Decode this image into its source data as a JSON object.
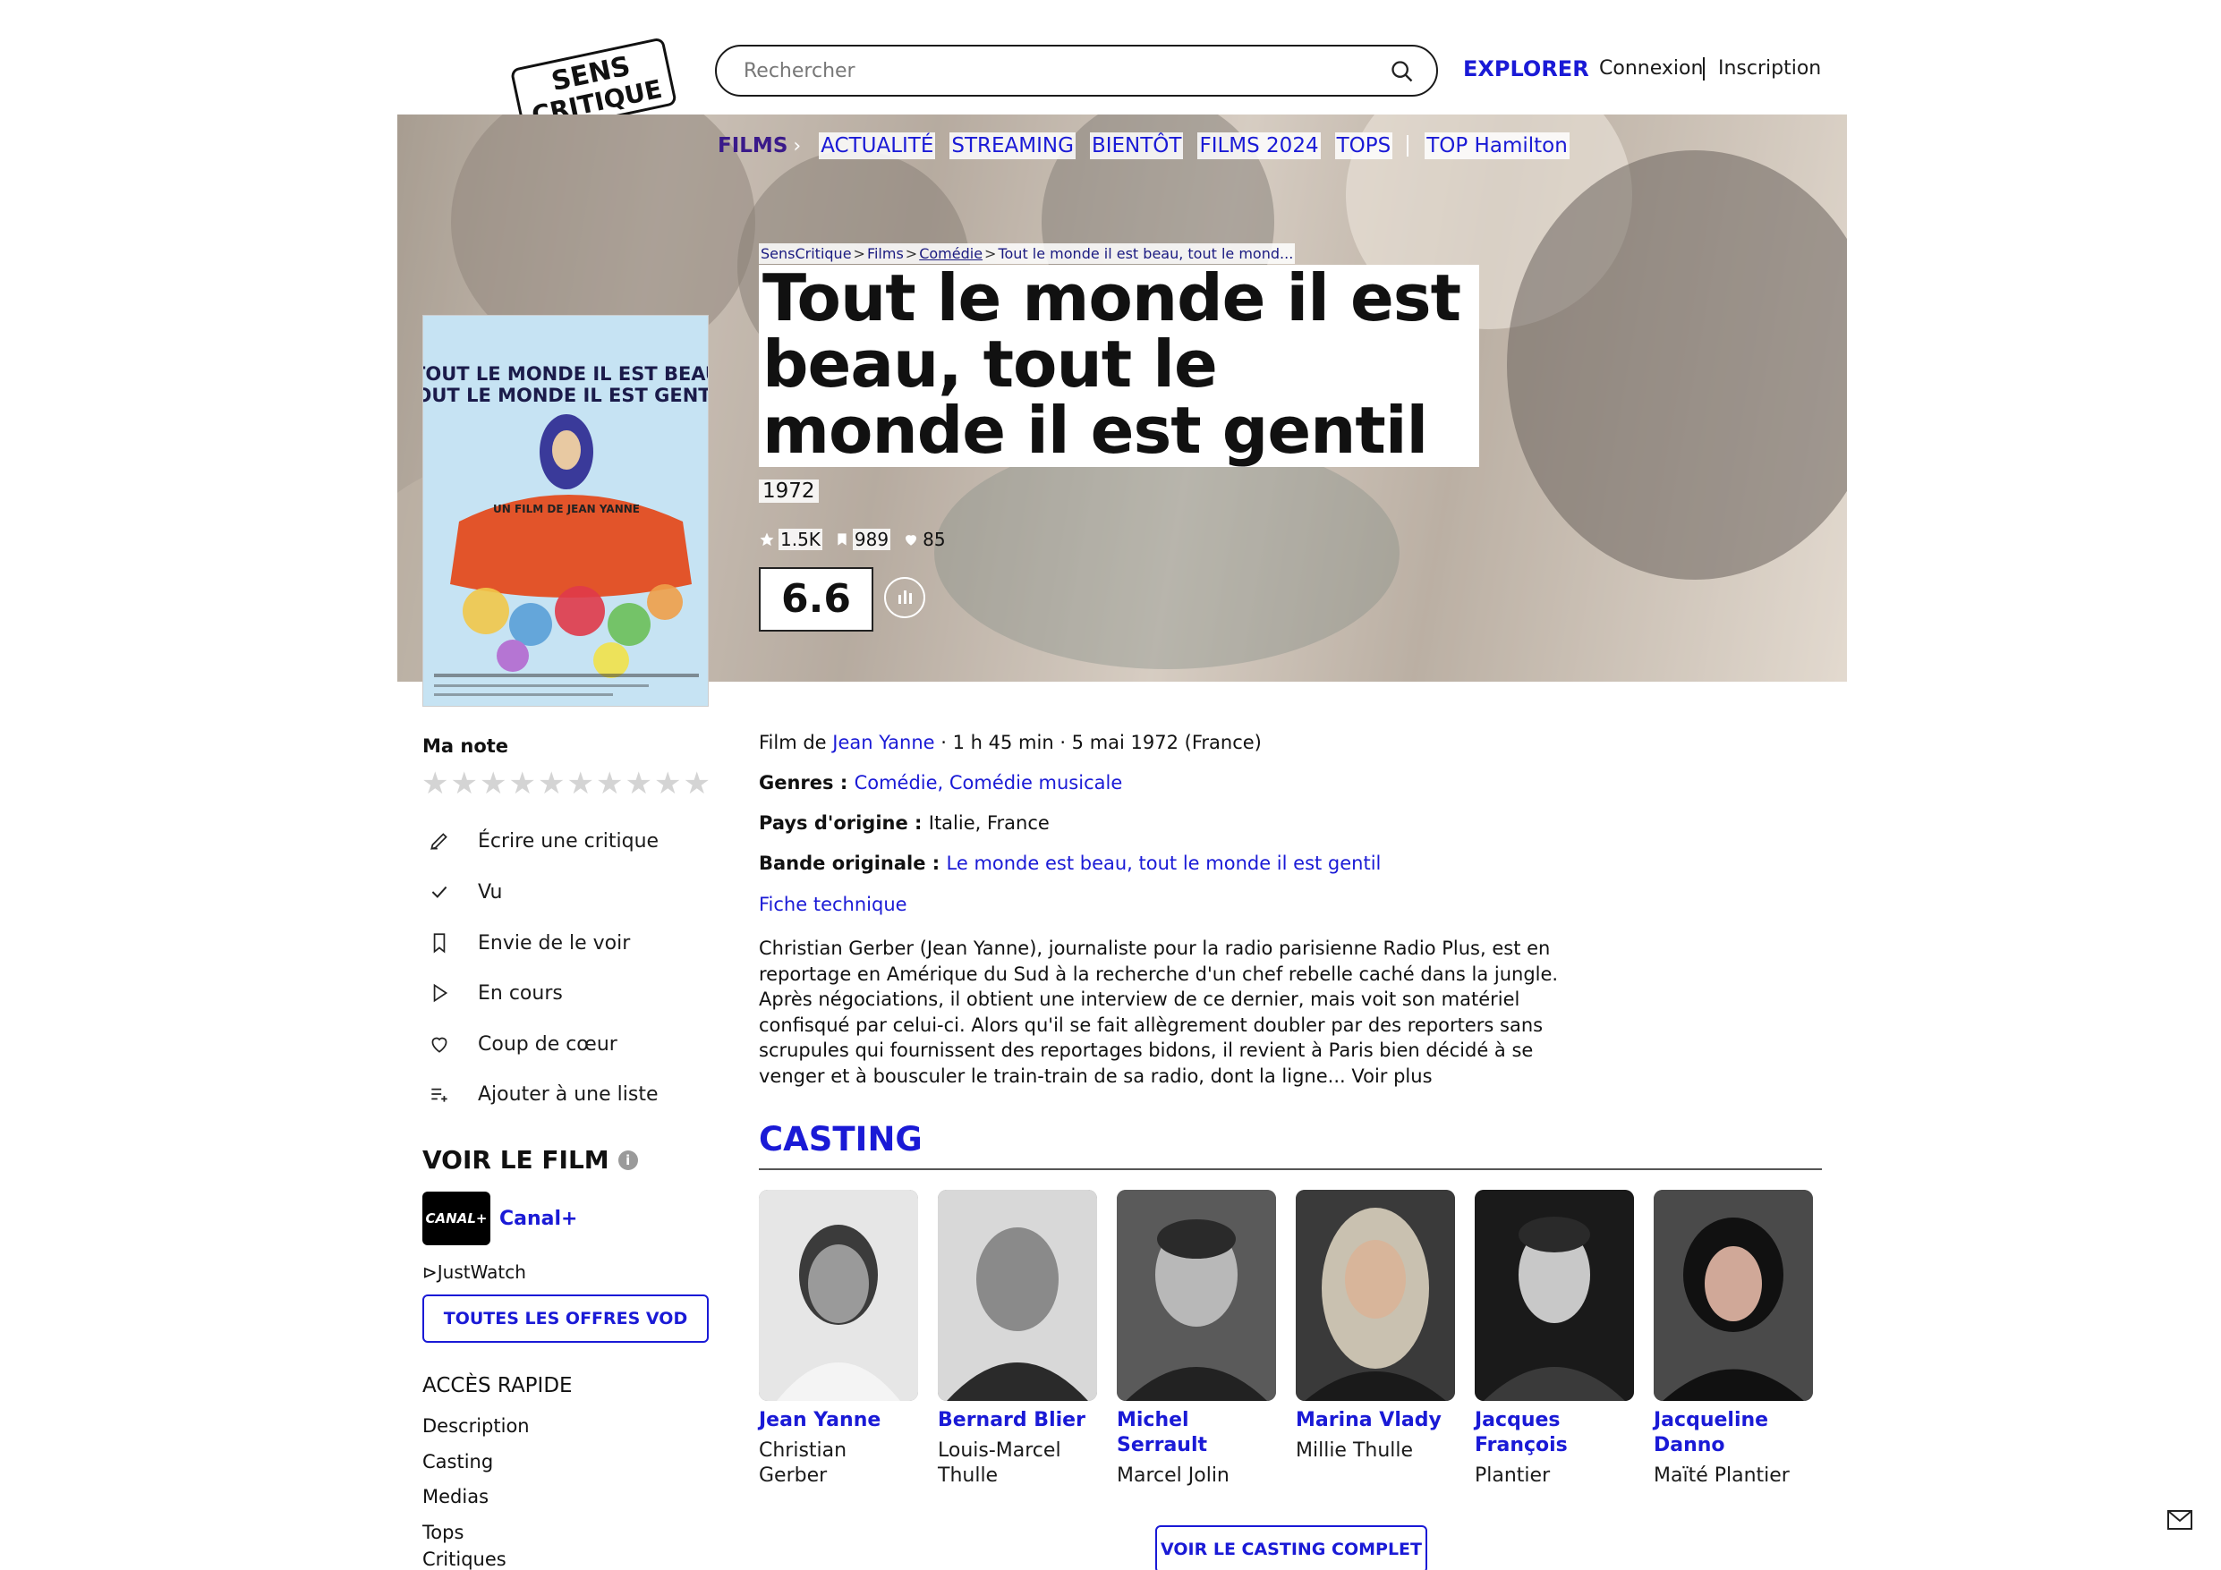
{
  "header": {
    "logo_text": [
      "SENS",
      "CRITIQUE"
    ],
    "search_placeholder": "Rechercher",
    "explorer": "EXPLORER",
    "connexion": "Connexion",
    "inscription": "Inscription"
  },
  "nav": {
    "films": "FILMS",
    "items": [
      "ACTUALITÉ",
      "STREAMING",
      "BIENTÔT",
      "FILMS 2024",
      "TOPS"
    ],
    "top": "TOP Hamilton"
  },
  "breadcrumb": [
    "SensCritique",
    "Films",
    "Comédie",
    "Tout le monde il est beau, tout le mond..."
  ],
  "film": {
    "title": "Tout le monde il est beau, tout le monde il est gentil",
    "year": "1972",
    "stats": {
      "ratings": "1.5K",
      "wishlist": "989",
      "favorites": "85"
    },
    "score": "6.6"
  },
  "poster": {
    "line1": "TOUT LE MONDE IL EST BEAU",
    "line2": "TOUT LE MONDE IL EST GENTIL",
    "subtitle": "UN FILM DE JEAN YANNE"
  },
  "left": {
    "ma_note": "Ma note",
    "actions": [
      "Écrire une critique",
      "Vu",
      "Envie de le voir",
      "En cours",
      "Coup de cœur",
      "Ajouter à une liste"
    ],
    "voir_le_film": "VOIR LE FILM",
    "info_glyph": "i",
    "canal_logo": "CANAL+",
    "canal_label": "Canal+",
    "justwatch": "JustWatch",
    "vod_button": "TOUTES LES OFFRES VOD",
    "acces_rapide": "ACCÈS RAPIDE",
    "quick_links": [
      "Description",
      "Casting",
      "Medias",
      "Tops",
      "Critiques"
    ]
  },
  "details": {
    "film_de_prefix": "Film de ",
    "director": "Jean Yanne",
    "meta": " · 1 h 45 min · 5 mai 1972 (France)",
    "genres_label": "Genres : ",
    "genres": "Comédie, Comédie musicale",
    "pays_label": "Pays d'origine : ",
    "pays": "Italie, France",
    "bande_label": "Bande originale : ",
    "bande": "Le monde est beau, tout le monde il est gentil",
    "fiche": "Fiche technique",
    "synopsis": "Christian Gerber (Jean Yanne), journaliste pour la radio parisienne Radio Plus, est en reportage en Amérique du Sud à la recherche d'un chef rebelle caché dans la jungle. Après négociations, il obtient une interview de ce dernier, mais voit son matériel confisqué par celui-ci. Alors qu'il se fait allègrement doubler par des reporters sans scrupules qui fournissent des reportages bidons, il revient à Paris bien décidé à se venger et à bousculer le train-train de sa radio, dont la ligne... Voir plus"
  },
  "casting": {
    "title": "CASTING",
    "members": [
      {
        "name": "Jean Yanne",
        "role": "Christian Gerber"
      },
      {
        "name": "Bernard Blier",
        "role": "Louis-Marcel Thulle"
      },
      {
        "name": "Michel Serrault",
        "role": "Marcel Jolin"
      },
      {
        "name": "Marina Vlady",
        "role": "Millie Thulle"
      },
      {
        "name": "Jacques François",
        "role": "Plantier"
      },
      {
        "name": "Jacqueline Danno",
        "role": "Maïté Plantier"
      }
    ],
    "button": "VOIR LE CASTING COMPLET"
  },
  "colors": {
    "accent": "#1a1ad6",
    "title": "#111111"
  }
}
